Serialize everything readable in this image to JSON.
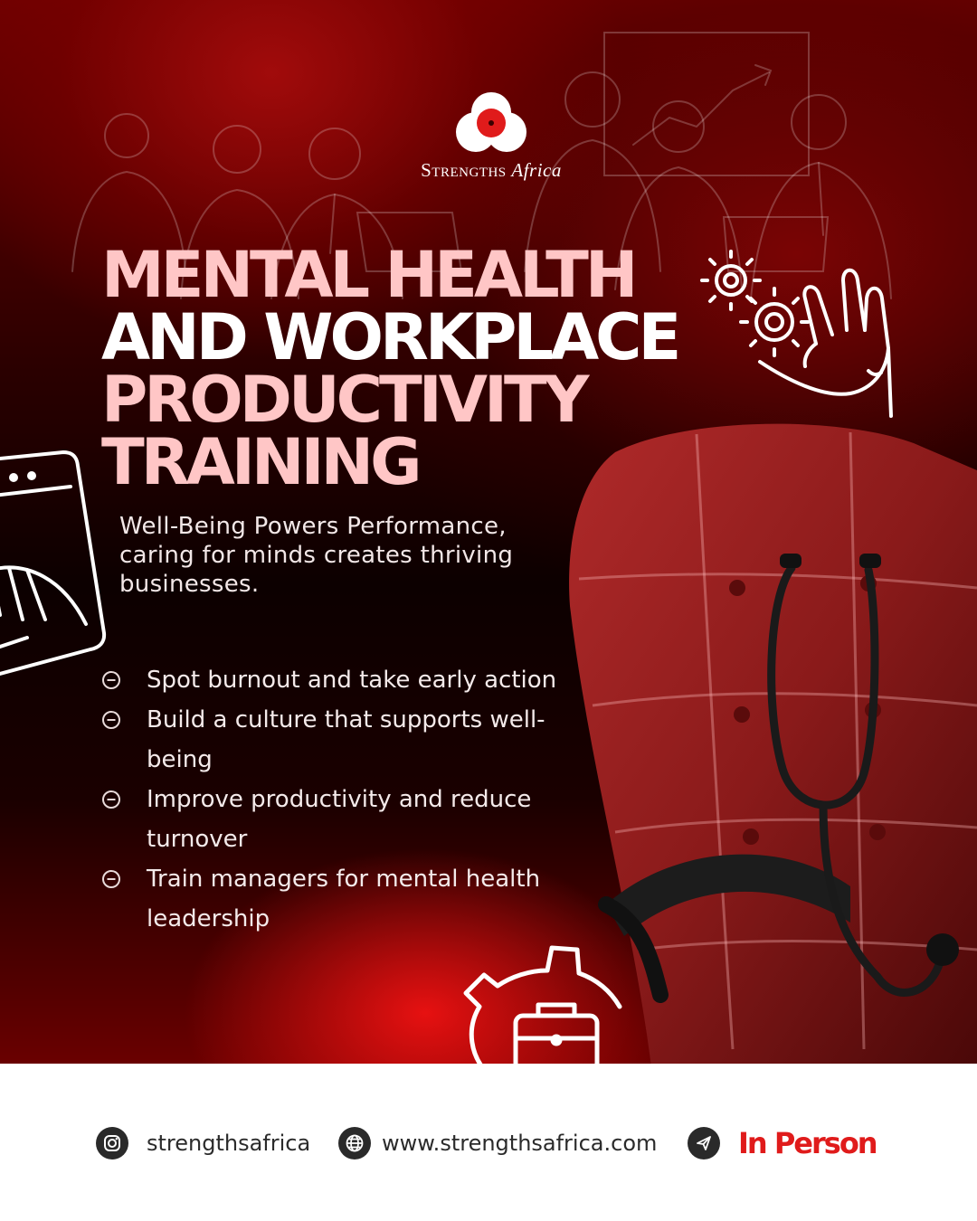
{
  "brand": {
    "name_main": "Strengths",
    "name_accent": "Africa"
  },
  "headline": {
    "line1": "MENTAL HEALTH",
    "line2": "AND WORKPLACE",
    "line3": "PRODUCTIVITY",
    "line4": "TRAINING"
  },
  "tagline": "Well-Being Powers Performance, caring for minds creates thriving businesses.",
  "bullets": [
    "Spot burnout and take early action",
    "Build a culture that supports well-being",
    "Improve productivity and reduce turnover",
    "Train managers for mental health leadership"
  ],
  "footer": {
    "instagram_handle": "strengthsafrica",
    "website": "www.strengthsafrica.com",
    "format": "In Person"
  },
  "icons": {
    "logo": "three-petal-logo-icon",
    "bullet": "circle-minus-icon",
    "instagram": "instagram-icon",
    "website": "globe-icon",
    "format": "send-icon"
  },
  "colors": {
    "accent": "#e01b1b",
    "headline_pink": "#ffc6c6",
    "dark_red": "#6e0000",
    "chair_red": "#8a1a1a"
  }
}
